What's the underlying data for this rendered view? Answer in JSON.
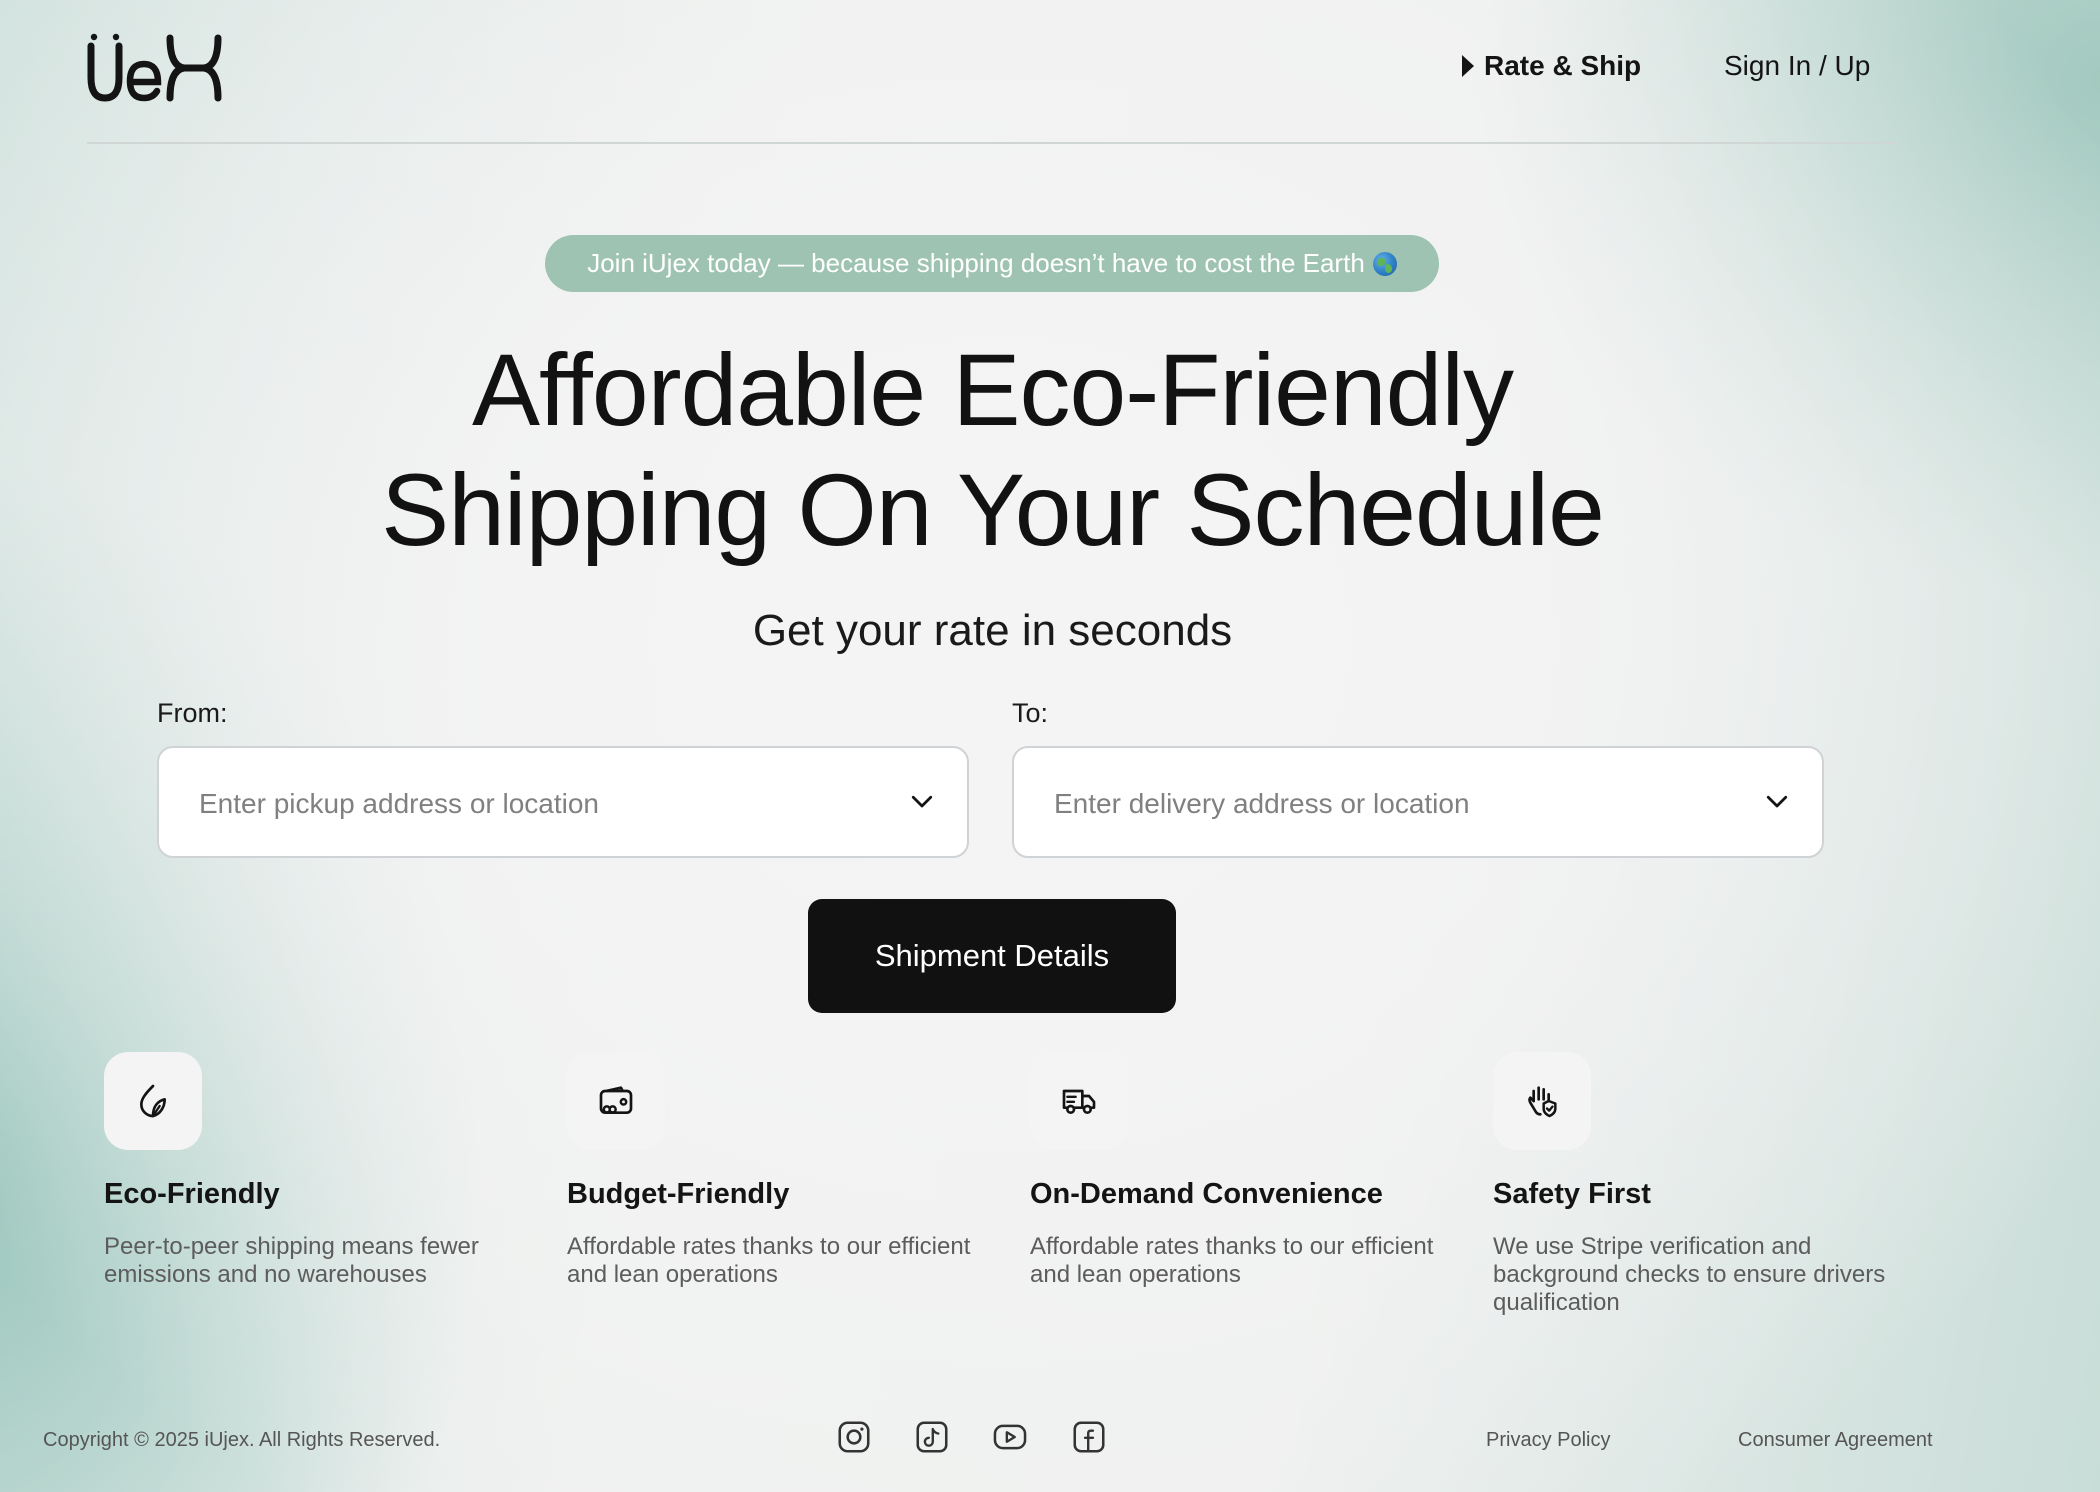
{
  "header": {
    "logo_text": "UeX",
    "nav": {
      "rate_ship": "Rate & Ship",
      "sign_in": "Sign In / Up"
    }
  },
  "promo": {
    "text": "Join iUjex today — because shipping doesn’t have to cost the Earth",
    "icon": "globe-emoji"
  },
  "hero": {
    "title_line1": "Affordable Eco-Friendly",
    "title_line2": "Shipping On Your Schedule",
    "subtitle": "Get your rate in seconds"
  },
  "form": {
    "from_label": "From:",
    "from_placeholder": "Enter pickup address or location",
    "to_label": "To:",
    "to_placeholder": "Enter delivery address or location",
    "submit_label": "Shipment Details"
  },
  "features": [
    {
      "icon": "leaf-drop-icon",
      "title": "Eco-Friendly",
      "description": "Peer-to-peer shipping means fewer emissions and no warehouses"
    },
    {
      "icon": "wallet-icon",
      "title": "Budget-Friendly",
      "description": "Affordable rates thanks to our efficient and lean operations"
    },
    {
      "icon": "delivery-truck-icon",
      "title": "On-Demand Convenience",
      "description": "Affordable rates thanks to our efficient and lean operations"
    },
    {
      "icon": "hand-shield-icon",
      "title": "Safety First",
      "description": "We use Stripe verification and background checks to ensure drivers qualification"
    }
  ],
  "footer": {
    "copyright": "Copyright © 2025 iUjex. All Rights Reserved.",
    "social": [
      "instagram-icon",
      "tiktok-icon",
      "youtube-icon",
      "facebook-icon"
    ],
    "links": {
      "privacy": "Privacy Policy",
      "consumer": "Consumer Agreement"
    }
  },
  "colors": {
    "accent_pill": "#9ec3b2",
    "cta": "#111111",
    "text": "#141414",
    "muted": "#5c5c5c"
  }
}
